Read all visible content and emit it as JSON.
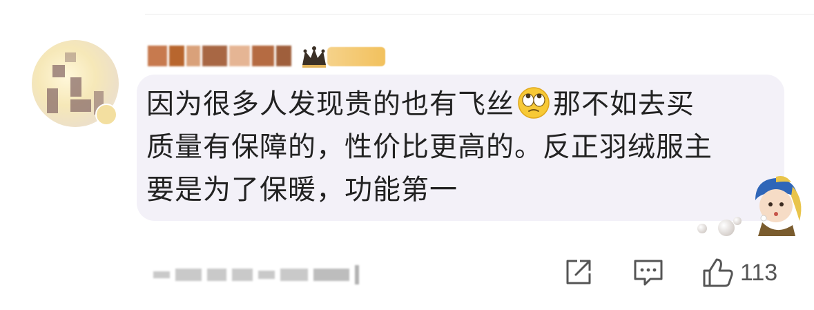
{
  "comment": {
    "line1": "因为很多人发现贵的也有飞丝",
    "line1_after_emoji": "那不如去买",
    "line2": "质量有保障的，性价比更高的。反正羽绒服主",
    "line3": "要是为了保暖，功能第一",
    "emoji_icon": "rolling-eyes-emoji-icon"
  },
  "actions": {
    "share_icon": "share-icon",
    "reply_icon": "comment-icon",
    "like_icon": "thumbs-up-icon",
    "like_count": "113"
  },
  "colors": {
    "bubble_bg": "#f3f1f8",
    "text": "#222222",
    "icon_gray": "#555555"
  }
}
